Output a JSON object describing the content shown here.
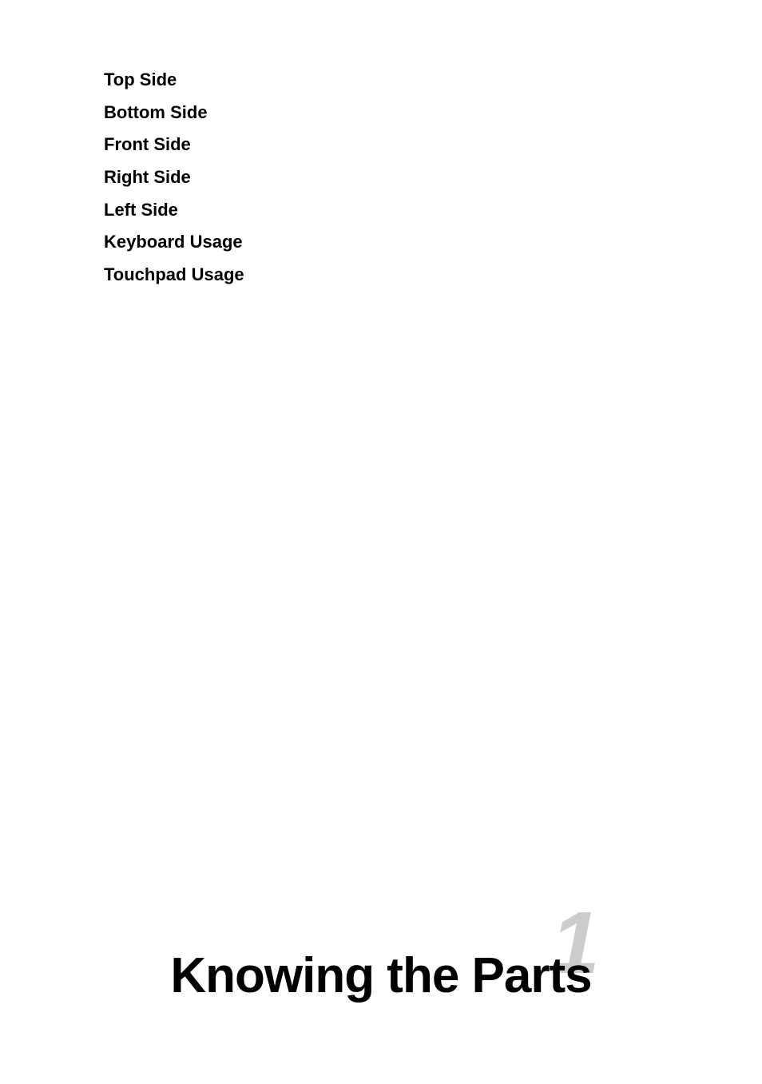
{
  "nav": {
    "items": [
      {
        "id": "top-side",
        "label": "Top Side"
      },
      {
        "id": "bottom-side",
        "label": "Bottom Side"
      },
      {
        "id": "front-side",
        "label": "Front Side"
      },
      {
        "id": "right-side",
        "label": "Right Side"
      },
      {
        "id": "left-side",
        "label": "Left Side"
      },
      {
        "id": "keyboard-usage",
        "label": "Keyboard Usage"
      },
      {
        "id": "touchpad-usage",
        "label": "Touchpad Usage"
      }
    ]
  },
  "chapter": {
    "number": "1",
    "title": "Knowing the Parts"
  }
}
